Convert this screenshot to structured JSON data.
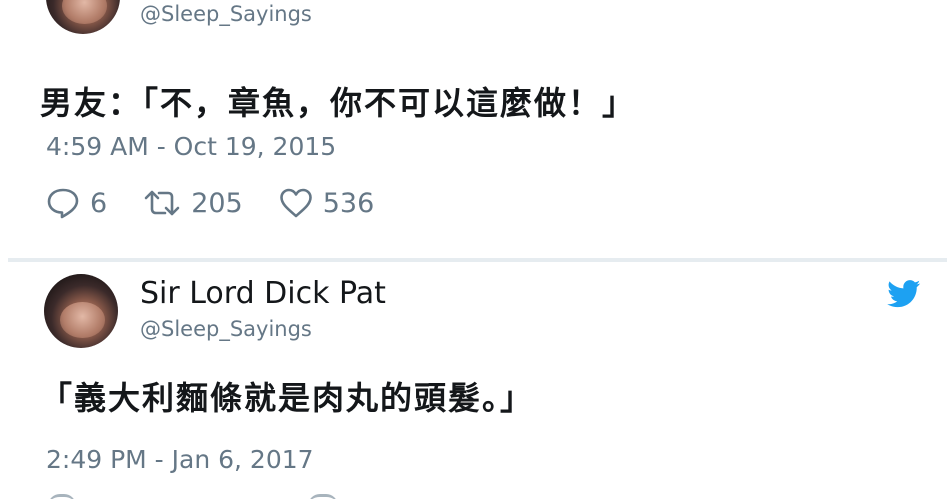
{
  "tweet1": {
    "handle": "@Sleep_Sayings",
    "text": "男友：「不，章魚，你不可以這麼做！」",
    "timestamp": "4:59 AM - Oct 19, 2015",
    "replies": "6",
    "retweets": "205",
    "likes": "536"
  },
  "tweet2": {
    "display_name": "Sir Lord Dick Pat",
    "handle": "@Sleep_Sayings",
    "text": "「義大利麵條就是肉丸的頭髮。」",
    "timestamp": "2:49 PM - Jan 6, 2017"
  },
  "colors": {
    "text_primary": "#14171a",
    "text_secondary": "#657786",
    "twitter_blue": "#1da1f2",
    "divider": "#e6ecf0"
  },
  "icons": [
    "reply-icon",
    "retweet-icon",
    "like-icon",
    "twitter-bird-icon"
  ]
}
